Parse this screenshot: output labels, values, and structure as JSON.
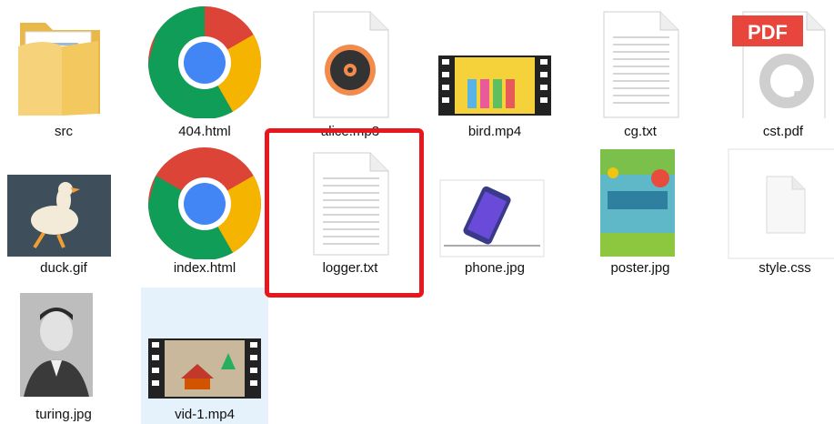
{
  "files": [
    {
      "name": "src",
      "type": "folder"
    },
    {
      "name": "404.html",
      "type": "html"
    },
    {
      "name": "alice.mp3",
      "type": "audio"
    },
    {
      "name": "bird.mp4",
      "type": "video"
    },
    {
      "name": "cg.txt",
      "type": "text"
    },
    {
      "name": "cst.pdf",
      "type": "pdf",
      "badge": "PDF"
    },
    {
      "name": "duck.gif",
      "type": "image"
    },
    {
      "name": "index.html",
      "type": "html"
    },
    {
      "name": "logger.txt",
      "type": "text",
      "highlighted": true
    },
    {
      "name": "phone.jpg",
      "type": "image"
    },
    {
      "name": "poster.jpg",
      "type": "image"
    },
    {
      "name": "style.css",
      "type": "css"
    },
    {
      "name": "turing.jpg",
      "type": "image"
    },
    {
      "name": "vid-1.mp4",
      "type": "video",
      "selected": true
    }
  ],
  "colors": {
    "highlight_border": "#e8171d",
    "selection_background": "#e5f1fb",
    "pdf_badge": "#e8453c"
  }
}
